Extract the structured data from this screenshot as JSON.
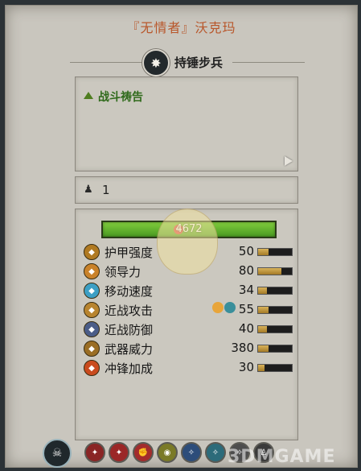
{
  "title": "『无情者』沃克玛",
  "unit": {
    "name": "持锤步兵",
    "badge_icon": "star-burst-icon"
  },
  "ability": {
    "name": "战斗祷告"
  },
  "rank": {
    "value": "1"
  },
  "hp": {
    "value": "4672"
  },
  "stats": [
    {
      "label": "护甲强度",
      "value": "50",
      "fill": 0.3,
      "icon": "armor-icon",
      "color": "#b07a22"
    },
    {
      "label": "领导力",
      "value": "80",
      "fill": 0.7,
      "icon": "leadership-icon",
      "color": "#c9822a"
    },
    {
      "label": "移动速度",
      "value": "34",
      "fill": 0.25,
      "icon": "speed-icon",
      "color": "#3c9fc4"
    },
    {
      "label": "近战攻击",
      "value": "55",
      "fill": 0.3,
      "icon": "melee-attack-icon",
      "color": "#b8842f"
    },
    {
      "label": "近战防御",
      "value": "40",
      "fill": 0.25,
      "icon": "melee-defense-icon",
      "color": "#4b5d88"
    },
    {
      "label": "武器威力",
      "value": "380",
      "fill": 0.3,
      "icon": "weapon-strength-icon",
      "color": "#9a6d24"
    },
    {
      "label": "冲锋加成",
      "value": "30",
      "fill": 0.2,
      "icon": "charge-bonus-icon",
      "color": "#c94b1e"
    }
  ],
  "watermark": "3DMGAME"
}
